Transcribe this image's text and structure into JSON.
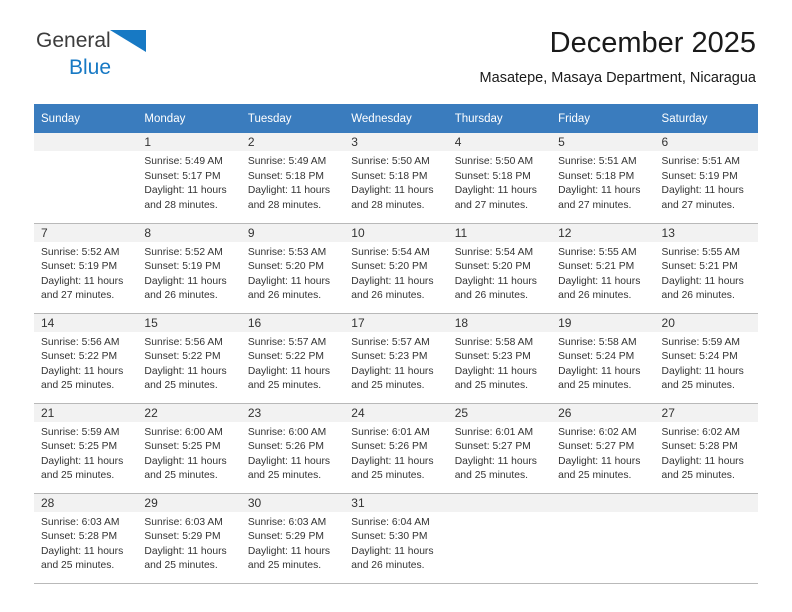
{
  "logo": {
    "word1": "General",
    "word2": "Blue",
    "triangle_color": "#1779c4",
    "word1_color": "#3c3c3c",
    "word2_color": "#1779c4"
  },
  "header": {
    "title": "December 2025",
    "subtitle": "Masatepe, Masaya Department, Nicaragua"
  },
  "theme": {
    "header_bg": "#3a7cbe",
    "header_text": "#ffffff",
    "daynum_bg": "#f2f2f2",
    "cell_border": "#b9b9b9",
    "body_text": "#333333"
  },
  "calendar": {
    "weekday_headers": [
      "Sunday",
      "Monday",
      "Tuesday",
      "Wednesday",
      "Thursday",
      "Friday",
      "Saturday"
    ],
    "weeks": [
      [
        {
          "day": "",
          "sunrise": "",
          "sunset": "",
          "daylight": ""
        },
        {
          "day": "1",
          "sunrise": "Sunrise: 5:49 AM",
          "sunset": "Sunset: 5:17 PM",
          "daylight": "Daylight: 11 hours and 28 minutes."
        },
        {
          "day": "2",
          "sunrise": "Sunrise: 5:49 AM",
          "sunset": "Sunset: 5:18 PM",
          "daylight": "Daylight: 11 hours and 28 minutes."
        },
        {
          "day": "3",
          "sunrise": "Sunrise: 5:50 AM",
          "sunset": "Sunset: 5:18 PM",
          "daylight": "Daylight: 11 hours and 28 minutes."
        },
        {
          "day": "4",
          "sunrise": "Sunrise: 5:50 AM",
          "sunset": "Sunset: 5:18 PM",
          "daylight": "Daylight: 11 hours and 27 minutes."
        },
        {
          "day": "5",
          "sunrise": "Sunrise: 5:51 AM",
          "sunset": "Sunset: 5:18 PM",
          "daylight": "Daylight: 11 hours and 27 minutes."
        },
        {
          "day": "6",
          "sunrise": "Sunrise: 5:51 AM",
          "sunset": "Sunset: 5:19 PM",
          "daylight": "Daylight: 11 hours and 27 minutes."
        }
      ],
      [
        {
          "day": "7",
          "sunrise": "Sunrise: 5:52 AM",
          "sunset": "Sunset: 5:19 PM",
          "daylight": "Daylight: 11 hours and 27 minutes."
        },
        {
          "day": "8",
          "sunrise": "Sunrise: 5:52 AM",
          "sunset": "Sunset: 5:19 PM",
          "daylight": "Daylight: 11 hours and 26 minutes."
        },
        {
          "day": "9",
          "sunrise": "Sunrise: 5:53 AM",
          "sunset": "Sunset: 5:20 PM",
          "daylight": "Daylight: 11 hours and 26 minutes."
        },
        {
          "day": "10",
          "sunrise": "Sunrise: 5:54 AM",
          "sunset": "Sunset: 5:20 PM",
          "daylight": "Daylight: 11 hours and 26 minutes."
        },
        {
          "day": "11",
          "sunrise": "Sunrise: 5:54 AM",
          "sunset": "Sunset: 5:20 PM",
          "daylight": "Daylight: 11 hours and 26 minutes."
        },
        {
          "day": "12",
          "sunrise": "Sunrise: 5:55 AM",
          "sunset": "Sunset: 5:21 PM",
          "daylight": "Daylight: 11 hours and 26 minutes."
        },
        {
          "day": "13",
          "sunrise": "Sunrise: 5:55 AM",
          "sunset": "Sunset: 5:21 PM",
          "daylight": "Daylight: 11 hours and 26 minutes."
        }
      ],
      [
        {
          "day": "14",
          "sunrise": "Sunrise: 5:56 AM",
          "sunset": "Sunset: 5:22 PM",
          "daylight": "Daylight: 11 hours and 25 minutes."
        },
        {
          "day": "15",
          "sunrise": "Sunrise: 5:56 AM",
          "sunset": "Sunset: 5:22 PM",
          "daylight": "Daylight: 11 hours and 25 minutes."
        },
        {
          "day": "16",
          "sunrise": "Sunrise: 5:57 AM",
          "sunset": "Sunset: 5:22 PM",
          "daylight": "Daylight: 11 hours and 25 minutes."
        },
        {
          "day": "17",
          "sunrise": "Sunrise: 5:57 AM",
          "sunset": "Sunset: 5:23 PM",
          "daylight": "Daylight: 11 hours and 25 minutes."
        },
        {
          "day": "18",
          "sunrise": "Sunrise: 5:58 AM",
          "sunset": "Sunset: 5:23 PM",
          "daylight": "Daylight: 11 hours and 25 minutes."
        },
        {
          "day": "19",
          "sunrise": "Sunrise: 5:58 AM",
          "sunset": "Sunset: 5:24 PM",
          "daylight": "Daylight: 11 hours and 25 minutes."
        },
        {
          "day": "20",
          "sunrise": "Sunrise: 5:59 AM",
          "sunset": "Sunset: 5:24 PM",
          "daylight": "Daylight: 11 hours and 25 minutes."
        }
      ],
      [
        {
          "day": "21",
          "sunrise": "Sunrise: 5:59 AM",
          "sunset": "Sunset: 5:25 PM",
          "daylight": "Daylight: 11 hours and 25 minutes."
        },
        {
          "day": "22",
          "sunrise": "Sunrise: 6:00 AM",
          "sunset": "Sunset: 5:25 PM",
          "daylight": "Daylight: 11 hours and 25 minutes."
        },
        {
          "day": "23",
          "sunrise": "Sunrise: 6:00 AM",
          "sunset": "Sunset: 5:26 PM",
          "daylight": "Daylight: 11 hours and 25 minutes."
        },
        {
          "day": "24",
          "sunrise": "Sunrise: 6:01 AM",
          "sunset": "Sunset: 5:26 PM",
          "daylight": "Daylight: 11 hours and 25 minutes."
        },
        {
          "day": "25",
          "sunrise": "Sunrise: 6:01 AM",
          "sunset": "Sunset: 5:27 PM",
          "daylight": "Daylight: 11 hours and 25 minutes."
        },
        {
          "day": "26",
          "sunrise": "Sunrise: 6:02 AM",
          "sunset": "Sunset: 5:27 PM",
          "daylight": "Daylight: 11 hours and 25 minutes."
        },
        {
          "day": "27",
          "sunrise": "Sunrise: 6:02 AM",
          "sunset": "Sunset: 5:28 PM",
          "daylight": "Daylight: 11 hours and 25 minutes."
        }
      ],
      [
        {
          "day": "28",
          "sunrise": "Sunrise: 6:03 AM",
          "sunset": "Sunset: 5:28 PM",
          "daylight": "Daylight: 11 hours and 25 minutes."
        },
        {
          "day": "29",
          "sunrise": "Sunrise: 6:03 AM",
          "sunset": "Sunset: 5:29 PM",
          "daylight": "Daylight: 11 hours and 25 minutes."
        },
        {
          "day": "30",
          "sunrise": "Sunrise: 6:03 AM",
          "sunset": "Sunset: 5:29 PM",
          "daylight": "Daylight: 11 hours and 25 minutes."
        },
        {
          "day": "31",
          "sunrise": "Sunrise: 6:04 AM",
          "sunset": "Sunset: 5:30 PM",
          "daylight": "Daylight: 11 hours and 26 minutes."
        },
        {
          "day": "",
          "sunrise": "",
          "sunset": "",
          "daylight": ""
        },
        {
          "day": "",
          "sunrise": "",
          "sunset": "",
          "daylight": ""
        },
        {
          "day": "",
          "sunrise": "",
          "sunset": "",
          "daylight": ""
        }
      ]
    ]
  }
}
